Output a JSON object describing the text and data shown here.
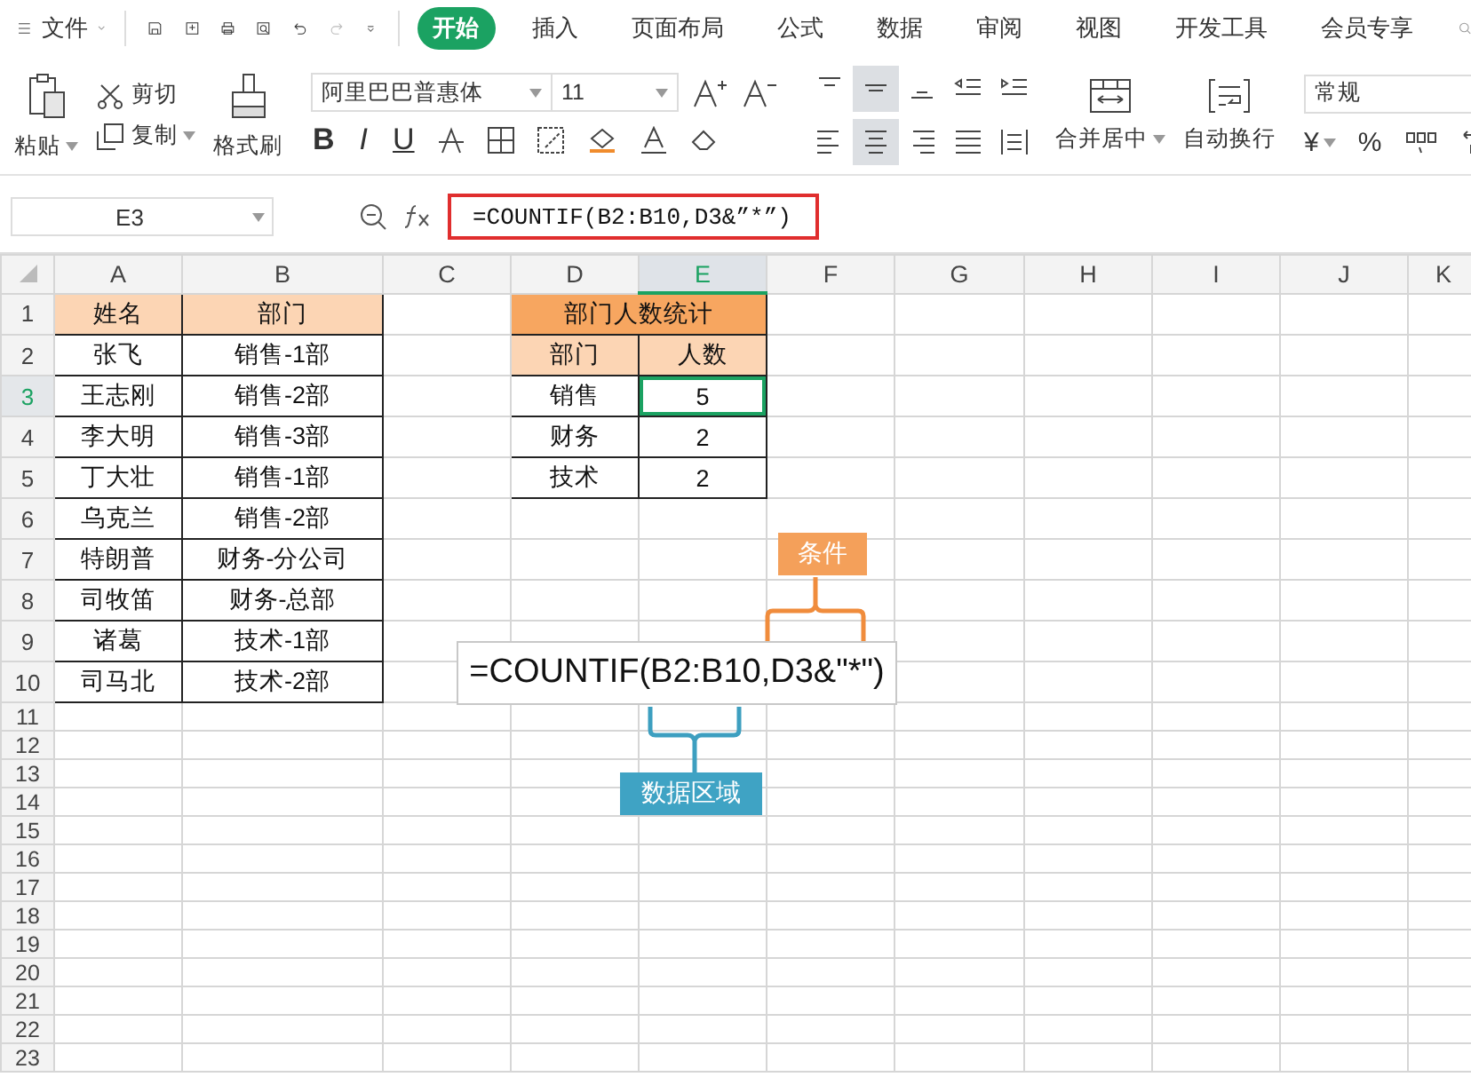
{
  "menu": {
    "file": "文件",
    "tabs": [
      {
        "label": "开始",
        "selected": true
      },
      {
        "label": "插入",
        "selected": false
      },
      {
        "label": "页面布局",
        "selected": false
      },
      {
        "label": "公式",
        "selected": false
      },
      {
        "label": "数据",
        "selected": false
      },
      {
        "label": "审阅",
        "selected": false
      },
      {
        "label": "视图",
        "selected": false
      },
      {
        "label": "开发工具",
        "selected": false
      },
      {
        "label": "会员专享",
        "selected": false
      }
    ]
  },
  "ribbon": {
    "paste": "粘贴",
    "cut": "剪切",
    "copy": "复制",
    "format_painter": "格式刷",
    "font_name": "阿里巴巴普惠体",
    "font_size": "11",
    "font_buttons": [
      "B",
      "I",
      "U"
    ],
    "align_buttons": [
      {
        "kind": "top",
        "selected": false
      },
      {
        "kind": "middle",
        "selected": true
      },
      {
        "kind": "bottom",
        "selected": false
      },
      {
        "kind": "outdent",
        "selected": false
      },
      {
        "kind": "indent",
        "selected": false
      },
      {
        "kind": "left",
        "selected": false
      },
      {
        "kind": "center",
        "selected": true
      },
      {
        "kind": "right",
        "selected": false
      },
      {
        "kind": "justify",
        "selected": false
      },
      {
        "kind": "distributed",
        "selected": false
      }
    ],
    "merge": "合并居中",
    "wrap": "自动换行",
    "number_format": "常规",
    "currency": "¥",
    "percent": "%"
  },
  "formula_bar": {
    "name_box": "E3",
    "formula": "=COUNTIF(B2:B10,D3&”*”)"
  },
  "sheet": {
    "columns": [
      {
        "label": "A",
        "selected": false
      },
      {
        "label": "B",
        "selected": false
      },
      {
        "label": "C",
        "selected": false
      },
      {
        "label": "D",
        "selected": false
      },
      {
        "label": "E",
        "selected": true
      },
      {
        "label": "F",
        "selected": false
      },
      {
        "label": "G",
        "selected": false
      },
      {
        "label": "H",
        "selected": false
      },
      {
        "label": "I",
        "selected": false
      },
      {
        "label": "J",
        "selected": false
      },
      {
        "label": "K",
        "selected": false
      }
    ],
    "rows": [
      {
        "label": "1",
        "selected": false,
        "cells": [
          {
            "kind": "head",
            "text": "姓名"
          },
          {
            "kind": "head",
            "text": "部门"
          },
          {
            "kind": "blank"
          },
          {
            "kind": "title",
            "text": "部门人数统计"
          }
        ]
      },
      {
        "label": "2",
        "selected": false,
        "cells": [
          {
            "kind": "data",
            "text": "张飞"
          },
          {
            "kind": "data",
            "text": "销售-1部"
          },
          {
            "kind": "blank"
          },
          {
            "kind": "head",
            "text": "部门"
          },
          {
            "kind": "head",
            "text": "人数"
          }
        ]
      },
      {
        "label": "3",
        "selected": true,
        "cells": [
          {
            "kind": "data",
            "text": "王志刚"
          },
          {
            "kind": "data",
            "text": "销售-2部"
          },
          {
            "kind": "blank"
          },
          {
            "kind": "data",
            "text": "销售"
          },
          {
            "kind": "data",
            "text": "5"
          }
        ]
      },
      {
        "label": "4",
        "selected": false,
        "cells": [
          {
            "kind": "data",
            "text": "李大明"
          },
          {
            "kind": "data",
            "text": "销售-3部"
          },
          {
            "kind": "blank"
          },
          {
            "kind": "data",
            "text": "财务"
          },
          {
            "kind": "data",
            "text": "2"
          }
        ]
      },
      {
        "label": "5",
        "selected": false,
        "cells": [
          {
            "kind": "data",
            "text": "丁大壮"
          },
          {
            "kind": "data",
            "text": "销售-1部"
          },
          {
            "kind": "blank"
          },
          {
            "kind": "data",
            "text": "技术"
          },
          {
            "kind": "data",
            "text": "2"
          }
        ]
      },
      {
        "label": "6",
        "selected": false,
        "cells": [
          {
            "kind": "data",
            "text": "乌克兰"
          },
          {
            "kind": "data",
            "text": "销售-2部"
          }
        ]
      },
      {
        "label": "7",
        "selected": false,
        "cells": [
          {
            "kind": "data",
            "text": "特朗普"
          },
          {
            "kind": "data",
            "text": "财务-分公司"
          }
        ]
      },
      {
        "label": "8",
        "selected": false,
        "cells": [
          {
            "kind": "data",
            "text": "司牧笛"
          },
          {
            "kind": "data",
            "text": "财务-总部"
          }
        ]
      },
      {
        "label": "9",
        "selected": false,
        "cells": [
          {
            "kind": "data",
            "text": "诸葛"
          },
          {
            "kind": "data",
            "text": "技术-1部"
          }
        ]
      },
      {
        "label": "10",
        "selected": false,
        "cells": [
          {
            "kind": "data",
            "text": "司马北"
          },
          {
            "kind": "data",
            "text": "技术-2部"
          }
        ]
      },
      {
        "label": "11",
        "selected": false
      },
      {
        "label": "12",
        "selected": false
      },
      {
        "label": "13",
        "selected": false
      },
      {
        "label": "14",
        "selected": false
      },
      {
        "label": "15",
        "selected": false
      },
      {
        "label": "16",
        "selected": false
      },
      {
        "label": "17",
        "selected": false
      },
      {
        "label": "18",
        "selected": false
      },
      {
        "label": "19",
        "selected": false
      },
      {
        "label": "20",
        "selected": false
      },
      {
        "label": "21",
        "selected": false
      },
      {
        "label": "22",
        "selected": false
      },
      {
        "label": "23",
        "selected": false
      }
    ]
  },
  "callout": {
    "formula": "=COUNTIF(B2:B10,D3&\"*\")",
    "condition_label": "条件",
    "range_label": "数据区域"
  }
}
